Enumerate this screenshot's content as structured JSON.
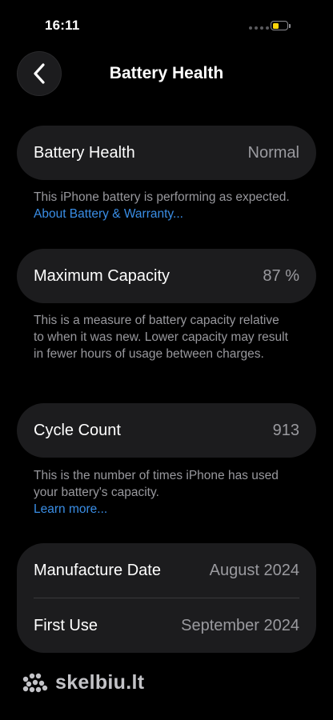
{
  "status_bar": {
    "time": "16:11",
    "battery_level": 0.45,
    "battery_color": "#ffd60a"
  },
  "nav": {
    "back_icon": "chevron-left-icon",
    "title": "Battery Health"
  },
  "battery_health": {
    "label": "Battery Health",
    "value": "Normal",
    "description": "This iPhone battery is performing as expected.",
    "link": "About Battery & Warranty..."
  },
  "maximum_capacity": {
    "label": "Maximum Capacity",
    "value": "87 %",
    "description": "This is a measure of battery capacity relative to when it was new. Lower capacity may result in fewer hours of usage between charges."
  },
  "cycle_count": {
    "label": "Cycle Count",
    "value": "913",
    "description": "This is the number of times iPhone has used your battery's capacity.",
    "link": "Learn more..."
  },
  "dates": {
    "manufacture_label": "Manufacture Date",
    "manufacture_value": "August 2024",
    "first_use_label": "First Use",
    "first_use_value": "September 2024"
  },
  "watermark": {
    "text": "skelbiu.lt",
    "icon": "dots-logo-icon"
  },
  "colors": {
    "background": "#000000",
    "card": "#1c1c1e",
    "link": "#3a8ee6",
    "secondary_text": "#98989d"
  }
}
